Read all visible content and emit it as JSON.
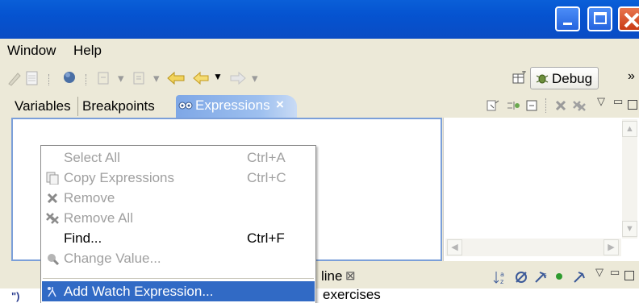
{
  "window": {
    "minimize_label": "Minimize",
    "maximize_label": "Maximize",
    "close_label": "Close"
  },
  "menubar": {
    "items": [
      "Window",
      "Help"
    ]
  },
  "toolbar": {
    "perspective_label": "Debug"
  },
  "views": {
    "tabs": [
      "Variables",
      "Breakpoints",
      "Expressions"
    ],
    "active_tab": "Expressions",
    "close_glyph": "×"
  },
  "bottom": {
    "outline_tab": "line",
    "outline_close": "⊠",
    "partial_text": "exercises",
    "left_fragment": "\")"
  },
  "context_menu": {
    "items": [
      {
        "label": "Select All",
        "accel": "Ctrl+A",
        "enabled": false,
        "icon": ""
      },
      {
        "label": "Copy Expressions",
        "accel": "Ctrl+C",
        "enabled": false,
        "icon": "copy-icon"
      },
      {
        "label": "Remove",
        "accel": "",
        "enabled": false,
        "icon": "remove-icon"
      },
      {
        "label": "Remove All",
        "accel": "",
        "enabled": false,
        "icon": "remove-all-icon"
      },
      {
        "label": "Find...",
        "accel": "Ctrl+F",
        "enabled": true,
        "icon": ""
      },
      {
        "label": "Change Value...",
        "accel": "",
        "enabled": false,
        "icon": "change-value-icon"
      },
      {
        "label": "Add Watch Expression...",
        "accel": "",
        "enabled": true,
        "icon": "watch-icon",
        "selected": true
      }
    ]
  },
  "colors": {
    "titlebar": "#0553d0",
    "selection": "#316ac5",
    "active_tab": "#7ea7e6",
    "disabled_text": "#a0a0a0"
  }
}
